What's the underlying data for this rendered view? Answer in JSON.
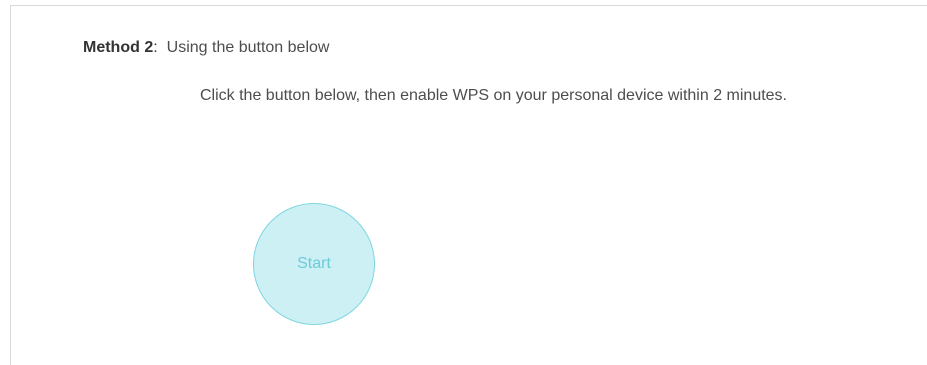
{
  "method": {
    "label": "Method 2",
    "colon": ":",
    "description": "Using the button below"
  },
  "instructions": "Click the button below, then enable WPS on your personal device within 2 minutes.",
  "start_button": {
    "label": "Start"
  },
  "colors": {
    "button_fill": "#cdf0f4",
    "button_border": "#7fd6e3",
    "button_text": "#6ccad9",
    "text": "#4d4d4d"
  }
}
